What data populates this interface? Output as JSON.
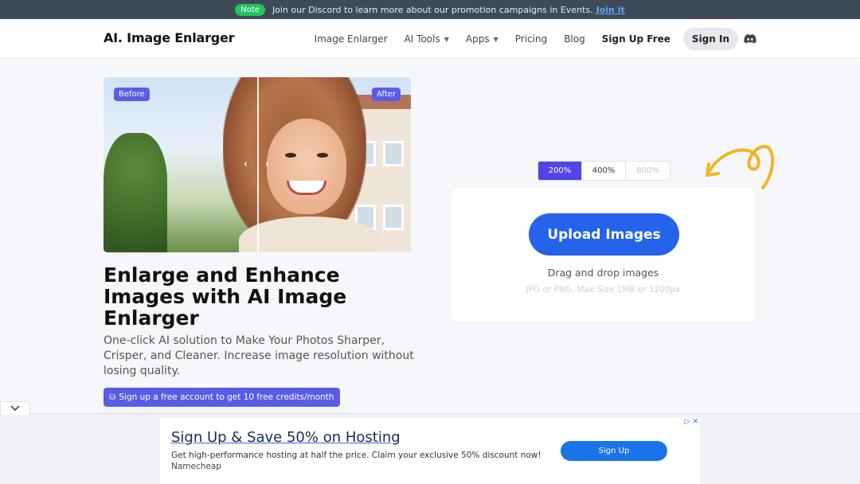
{
  "announcement": {
    "badge": "Note",
    "text": "Join our Discord to learn more about our promotion campaigns in Events.",
    "link": "Join it"
  },
  "header": {
    "logo": "AI. Image Enlarger",
    "nav": [
      {
        "label": "Image Enlarger"
      },
      {
        "label": "AI Tools"
      },
      {
        "label": "Apps"
      },
      {
        "label": "Pricing"
      },
      {
        "label": "Blog"
      }
    ],
    "sign_up": "Sign Up Free",
    "sign_in": "Sign In"
  },
  "hero": {
    "before_label": "Before",
    "after_label": "After",
    "headline": "Enlarge and Enhance Images with AI Image Enlarger",
    "subhead": "One-click AI solution to Make Your Photos Sharper, Crisper, and Cleaner. Increase image resolution without losing quality.",
    "promo": "Sign up a free account to get 10 free credits/month"
  },
  "uploader": {
    "scales": [
      "200%",
      "400%",
      "800%"
    ],
    "selected_scale": "200%",
    "upload_label": "Upload Images",
    "drag_text": "Drag and drop images",
    "limits": "JPG or PNG. Max Size 1MB or 1200px"
  },
  "ad": {
    "title": "Sign Up & Save 50% on Hosting",
    "description": "Get high-performance hosting at half the price. Claim your exclusive 50% discount now!",
    "brand": "Namecheap",
    "cta": "Sign Up"
  },
  "colors": {
    "accent": "#5b5ce6",
    "upload_button": "#2563eb",
    "announce_bg": "#3f4a59",
    "note_badge": "#22c55e"
  }
}
